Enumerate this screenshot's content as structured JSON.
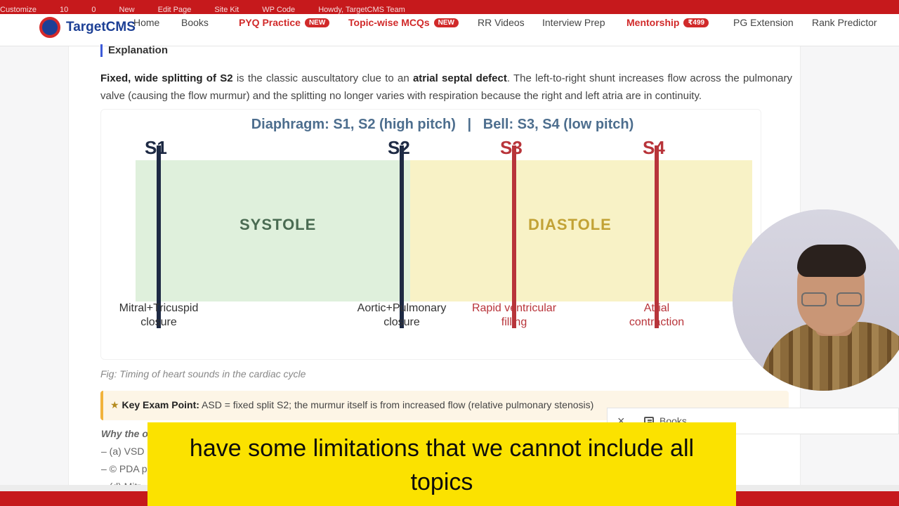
{
  "top_strip": [
    "Customize",
    "10",
    "0",
    "New",
    "Edit Page",
    "Site Kit",
    "WP Code",
    "Howdy, TargetCMS Team"
  ],
  "nav": {
    "logo_text": "TargetCMS",
    "items": [
      {
        "label": "Home",
        "badge": "",
        "red": false
      },
      {
        "label": "Books",
        "badge": "",
        "red": false
      },
      {
        "label": "PYQ Practice",
        "badge": "NEW",
        "red": true
      },
      {
        "label": "Topic-wise MCQs",
        "badge": "NEW",
        "red": true
      },
      {
        "label": "RR Videos",
        "badge": "",
        "red": false
      },
      {
        "label": "Interview Prep",
        "badge": "",
        "red": false
      },
      {
        "label": "Mentorship",
        "badge": "₹499",
        "red": true
      },
      {
        "label": "PG Extension",
        "badge": "",
        "red": false
      },
      {
        "label": "Rank Predictor",
        "badge": "",
        "red": false
      }
    ]
  },
  "explanation": {
    "heading": "Explanation",
    "bold1": "Fixed, wide splitting of S2",
    "text1": " is the classic auscultatory clue to an ",
    "bold2": "atrial septal defect",
    "text2": ". The left-to-right shunt increases flow across the pulmonary valve (causing the flow murmur) and the splitting no longer varies with respiration because the right and left atria are in continuity."
  },
  "figure": {
    "title": "Diaphragm: S1, S2 (high pitch)   |   Bell: S3, S4 (low pitch)",
    "systole_label": "SYSTOLE",
    "diastole_label": "DIASTOLE",
    "sounds": [
      {
        "name": "S1",
        "caption_line1": "Mitral+Tricuspid",
        "caption_line2": "closure",
        "color": "#1e2a44"
      },
      {
        "name": "S2",
        "caption_line1": "Aortic+Pulmonary",
        "caption_line2": "closure",
        "color": "#1e2a44"
      },
      {
        "name": "S3",
        "caption_line1": "Rapid ventricular",
        "caption_line2": "filling",
        "color": "#b8343a"
      },
      {
        "name": "S4",
        "caption_line1": "Atrial",
        "caption_line2": "contraction",
        "color": "#b8343a"
      }
    ],
    "caption": "Fig: Timing of heart sounds in the cardiac cycle"
  },
  "key_point": {
    "label": "Key Exam Point:",
    "text": " ASD = fixed split S2; the murmur itself is from increased flow (relative pulmonary stenosis)"
  },
  "why_others": {
    "heading": "Why the o",
    "options": [
      "– (a) VSD c",
      "– © PDA p",
      "– (d) Mitr"
    ]
  },
  "popup": {
    "close": "×",
    "books": "Books"
  },
  "subtitle": {
    "line1": "have some limitations that we cannot include all",
    "line2": "topics"
  },
  "colors": {
    "brand_red": "#c6191c",
    "systole_bg": "#dff0dc",
    "diastole_bg": "#f8f2c6",
    "systole_text": "#4a6b52",
    "diastole_text": "#c2a235",
    "subtitle_bg": "#fbe200"
  }
}
